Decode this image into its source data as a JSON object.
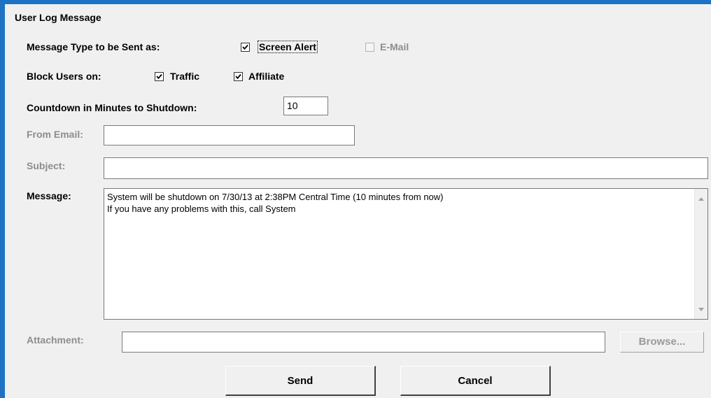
{
  "dialog": {
    "title": "User Log Message"
  },
  "message_type": {
    "label": "Message Type to be Sent as:",
    "options": [
      {
        "label": "Screen Alert",
        "checked": true,
        "enabled": true
      },
      {
        "label": "E-Mail",
        "checked": false,
        "enabled": false
      }
    ]
  },
  "block_users": {
    "label": "Block Users on:",
    "options": [
      {
        "label": "Traffic",
        "checked": true
      },
      {
        "label": "Affiliate",
        "checked": true
      }
    ]
  },
  "countdown": {
    "label": "Countdown in Minutes to Shutdown:",
    "value": "10"
  },
  "from_email": {
    "label": "From Email:",
    "value": ""
  },
  "subject": {
    "label": "Subject:",
    "value": ""
  },
  "message": {
    "label": "Message:",
    "value": "System will be shutdown on 7/30/13 at 2:38PM Central Time (10 minutes from now)\nIf you have any problems with this, call System"
  },
  "attachment": {
    "label": "Attachment:",
    "value": "",
    "browse_label": "Browse..."
  },
  "buttons": {
    "send_label": "Send",
    "cancel_label": "Cancel"
  },
  "colors": {
    "frame": "#1e72c4",
    "dialog_bg": "#f0f0f0",
    "disabled_text": "#8d8d8d"
  }
}
